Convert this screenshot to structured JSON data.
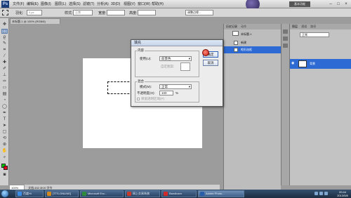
{
  "app": {
    "logo": "Ps",
    "workspace": "基本功能"
  },
  "menu": [
    "文件(F)",
    "编辑(E)",
    "图像(I)",
    "图层(L)",
    "选择(S)",
    "滤镜(T)",
    "分析(A)",
    "3D(D)",
    "视图(V)",
    "窗口(W)",
    "帮助(H)"
  ],
  "options": {
    "feather_label": "羽化:",
    "feather_value": "0 px",
    "style_label": "样式:",
    "style_value": "正常",
    "width_label": "宽度:",
    "height_label": "高度:",
    "refine_label": "调整边缘..."
  },
  "document": {
    "tab_title": "未标题-1 @ 100% (RGB/8)",
    "zoom": "100%",
    "status": "文档:452.3K/0 字节"
  },
  "history_panel": {
    "tabs": [
      "历史记录",
      "动作"
    ],
    "items": [
      {
        "label": "未标题-1",
        "selected": false
      },
      {
        "label": "新建",
        "selected": false
      },
      {
        "label": "矩形选框",
        "selected": true
      }
    ]
  },
  "layers_panel": {
    "tabs": [
      "图层",
      "通道",
      "路径"
    ],
    "blend": "正常",
    "layer_name": "背景"
  },
  "fill_dialog": {
    "title": "填充",
    "content_group": "内容",
    "use_label": "使用(U):",
    "use_value": "前景色",
    "custom_pattern_label": "自定图案:",
    "blending_group": "混合",
    "mode_label": "模式(M):",
    "mode_value": "正常",
    "opacity_label": "不透明度(O):",
    "opacity_value": "100",
    "opacity_unit": "%",
    "preserve_label": "保留透明区域(P)",
    "ok": "确定",
    "cancel": "取消"
  },
  "taskbar": {
    "tasks": [
      {
        "label": "百度Hi",
        "color": "#3a8ee6"
      },
      {
        "label": "[TTS-ONLINE]",
        "color": "#d08a20"
      },
      {
        "label": "Microsoft Exc...",
        "color": "#2f8a3c"
      },
      {
        "label": "网上交易系统",
        "color": "#c83a2a"
      },
      {
        "label": "Bandicam",
        "color": "#d12a2a"
      },
      {
        "label": "Adobe Photo...",
        "color": "#2a5ea8"
      }
    ],
    "clock_time": "20:44",
    "clock_date": "2013/5/8"
  }
}
